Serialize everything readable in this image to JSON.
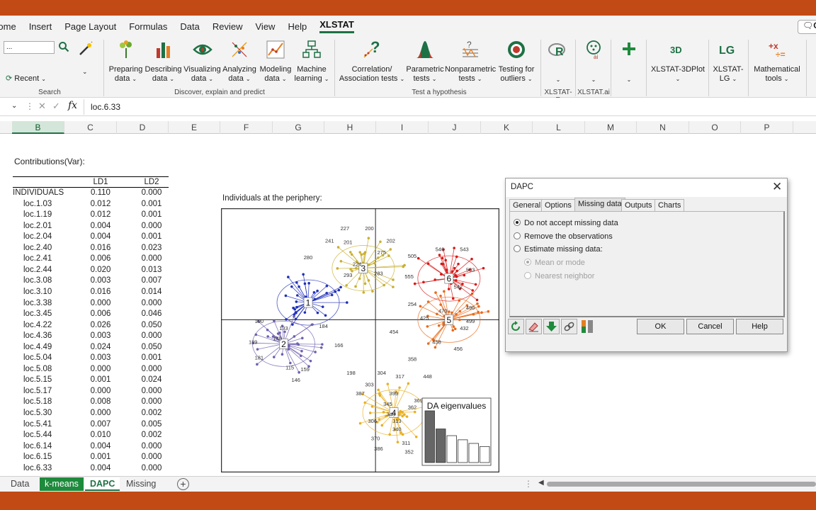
{
  "menu": [
    "Home",
    "Insert",
    "Page Layout",
    "Formulas",
    "Data",
    "Review",
    "View",
    "Help",
    "XLSTAT"
  ],
  "menu_active": "XLSTAT",
  "comments_label": "C",
  "ribbon": {
    "search_placeholder": "...",
    "recent_label": "Recent",
    "groups": {
      "search": "Search",
      "discover": "Discover, explain and predict",
      "test": "Test a hypothesis",
      "xlstat_r": "XLSTAT-R",
      "xlstat_ai": "XLSTAT.ai"
    },
    "buttons": {
      "preparing": [
        "Preparing",
        "data"
      ],
      "describing": [
        "Describing",
        "data"
      ],
      "visualizing": [
        "Visualizing",
        "data"
      ],
      "analyzing": [
        "Analyzing",
        "data"
      ],
      "modeling": [
        "Modeling",
        "data"
      ],
      "machine": [
        "Machine",
        "learning"
      ],
      "correlation": [
        "Correlation/",
        "Association tests"
      ],
      "parametric": [
        "Parametric",
        "tests"
      ],
      "nonparametric": [
        "Nonparametric",
        "tests"
      ],
      "outliers": [
        "Testing for",
        "outliers"
      ],
      "plot3d": [
        "XLSTAT-3DPlot",
        ""
      ],
      "lg": [
        "XLSTAT-",
        "LG"
      ],
      "math": [
        "Mathematical",
        "tools"
      ]
    },
    "icon_labels": {
      "threed": "3D",
      "lg": "LG"
    }
  },
  "formula_bar": {
    "fx": "fx",
    "content": "loc.6.33"
  },
  "columns": [
    "B",
    "C",
    "D",
    "E",
    "F",
    "G",
    "H",
    "I",
    "J",
    "K",
    "L",
    "M",
    "N",
    "O",
    "P"
  ],
  "selected_column": "B",
  "contributions": {
    "title": "Contributions(Var):",
    "headers": [
      "LD1",
      "LD2"
    ],
    "rows": [
      [
        "INDIVIDUALS",
        "0.110",
        "0.000"
      ],
      [
        "loc.1.03",
        "0.012",
        "0.001"
      ],
      [
        "loc.1.19",
        "0.012",
        "0.001"
      ],
      [
        "loc.2.01",
        "0.004",
        "0.000"
      ],
      [
        "loc.2.04",
        "0.004",
        "0.001"
      ],
      [
        "loc.2.40",
        "0.016",
        "0.023"
      ],
      [
        "loc.2.41",
        "0.006",
        "0.000"
      ],
      [
        "loc.2.44",
        "0.020",
        "0.013"
      ],
      [
        "loc.3.08",
        "0.003",
        "0.007"
      ],
      [
        "loc.3.10",
        "0.016",
        "0.014"
      ],
      [
        "loc.3.38",
        "0.000",
        "0.000"
      ],
      [
        "loc.3.45",
        "0.006",
        "0.046"
      ],
      [
        "loc.4.22",
        "0.026",
        "0.050"
      ],
      [
        "loc.4.36",
        "0.003",
        "0.000"
      ],
      [
        "loc.4.49",
        "0.024",
        "0.050"
      ],
      [
        "loc.5.04",
        "0.003",
        "0.001"
      ],
      [
        "loc.5.08",
        "0.000",
        "0.000"
      ],
      [
        "loc.5.15",
        "0.001",
        "0.024"
      ],
      [
        "loc.5.17",
        "0.000",
        "0.000"
      ],
      [
        "loc.5.18",
        "0.008",
        "0.000"
      ],
      [
        "loc.5.30",
        "0.000",
        "0.002"
      ],
      [
        "loc.5.41",
        "0.007",
        "0.005"
      ],
      [
        "loc.5.44",
        "0.010",
        "0.002"
      ],
      [
        "loc.6.14",
        "0.004",
        "0.000"
      ],
      [
        "loc.6.15",
        "0.001",
        "0.000"
      ],
      [
        "loc.6.33",
        "0.004",
        "0.000"
      ]
    ]
  },
  "chart_data": {
    "type": "scatter",
    "title": "Individuals at the periphery:",
    "clusters": [
      {
        "name": "1",
        "color": "#2030b8",
        "center": [
          -1.1,
          0.25
        ]
      },
      {
        "name": "2",
        "color": "#7060b0",
        "center": [
          -1.5,
          -0.35
        ]
      },
      {
        "name": "3",
        "color": "#c8b030",
        "center": [
          -0.2,
          0.75
        ]
      },
      {
        "name": "4",
        "color": "#e8b020",
        "center": [
          0.3,
          -1.35
        ]
      },
      {
        "name": "5",
        "color": "#e86a1a",
        "center": [
          1.2,
          0.0
        ]
      },
      {
        "name": "6",
        "color": "#d81818",
        "center": [
          1.2,
          0.6
        ]
      }
    ],
    "point_labels": [
      [
        "227",
        -0.5,
        1.3
      ],
      [
        "200",
        -0.1,
        1.3
      ],
      [
        "241",
        -0.75,
        1.12
      ],
      [
        "201",
        -0.45,
        1.1
      ],
      [
        "202",
        0.25,
        1.12
      ],
      [
        "280",
        -1.1,
        0.88
      ],
      [
        "275",
        0.1,
        0.95
      ],
      [
        "224",
        -0.3,
        0.78
      ],
      [
        "293",
        -0.45,
        0.62
      ],
      [
        "283",
        0.05,
        0.65
      ],
      [
        "190",
        -1.9,
        -0.05
      ],
      [
        "133",
        -1.5,
        -0.15
      ],
      [
        "149",
        -1.6,
        -0.3
      ],
      [
        "189",
        -2.0,
        -0.35
      ],
      [
        "181",
        -1.9,
        -0.58
      ],
      [
        "115",
        -1.4,
        -0.72
      ],
      [
        "159",
        -1.15,
        -0.75
      ],
      [
        "146",
        -1.3,
        -0.9
      ],
      [
        "184",
        -0.85,
        -0.12
      ],
      [
        "166",
        -0.6,
        -0.4
      ],
      [
        "198",
        -0.4,
        -0.8
      ],
      [
        "505",
        0.6,
        0.9
      ],
      [
        "546",
        1.05,
        1.0
      ],
      [
        "543",
        1.45,
        1.0
      ],
      [
        "555",
        0.55,
        0.6
      ],
      [
        "503",
        1.55,
        0.7
      ],
      [
        "542",
        1.35,
        0.45
      ],
      [
        "254",
        0.6,
        0.2
      ],
      [
        "496",
        1.55,
        0.15
      ],
      [
        "425",
        0.8,
        0.0
      ],
      [
        "470",
        1.1,
        0.1
      ],
      [
        "499",
        1.55,
        -0.05
      ],
      [
        "454",
        0.3,
        -0.2
      ],
      [
        "458",
        1.0,
        -0.35
      ],
      [
        "456",
        1.35,
        -0.45
      ],
      [
        "432",
        1.45,
        -0.15
      ],
      [
        "448",
        0.85,
        -0.85
      ],
      [
        "358",
        0.6,
        -0.6
      ],
      [
        "304",
        0.1,
        -0.8
      ],
      [
        "317",
        0.4,
        -0.85
      ],
      [
        "303",
        -0.1,
        -0.97
      ],
      [
        "387",
        -0.25,
        -1.1
      ],
      [
        "399",
        0.3,
        -1.1
      ],
      [
        "345",
        0.2,
        -1.25
      ],
      [
        "348",
        0.25,
        -1.4
      ],
      [
        "313",
        0.35,
        -1.5
      ],
      [
        "306",
        -0.05,
        -1.5
      ],
      [
        "340",
        0.35,
        -1.62
      ],
      [
        "370",
        0.0,
        -1.75
      ],
      [
        "386",
        0.05,
        -1.9
      ],
      [
        "311",
        0.5,
        -1.82
      ],
      [
        "352",
        0.55,
        -1.95
      ],
      [
        "369",
        0.7,
        -1.2
      ],
      [
        "362",
        0.6,
        -1.3
      ],
      [
        "380",
        0.95,
        -1.45
      ]
    ],
    "xlim": [
      -2.5,
      2.0
    ],
    "ylim": [
      -2.2,
      1.6
    ],
    "inset": {
      "title": "DA eigenvalues",
      "values": [
        100,
        65,
        52,
        44,
        37,
        31
      ],
      "filled": 2
    }
  },
  "sheet_tabs": [
    "Data",
    "k-means",
    "DAPC",
    "Missing"
  ],
  "active_tab": "DAPC",
  "dialog": {
    "title": "DAPC",
    "tabs": [
      "General",
      "Options",
      "Missing data",
      "Outputs",
      "Charts"
    ],
    "active_tab": "Missing data",
    "options": [
      {
        "label": "Do not accept missing data",
        "checked": true,
        "disabled": false
      },
      {
        "label": "Remove the observations",
        "checked": false,
        "disabled": false
      },
      {
        "label": "Estimate missing data:",
        "checked": false,
        "disabled": false
      },
      {
        "label": "Mean or mode",
        "checked": true,
        "disabled": true
      },
      {
        "label": "Nearest neighbor",
        "checked": false,
        "disabled": true
      }
    ],
    "buttons": {
      "ok": "OK",
      "cancel": "Cancel",
      "help": "Help"
    }
  }
}
